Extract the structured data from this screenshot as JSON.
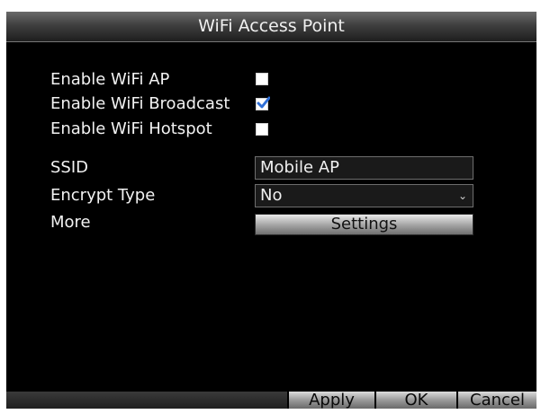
{
  "window": {
    "title": "WiFi Access Point"
  },
  "options": [
    {
      "label": "Enable WiFi AP",
      "checked": false
    },
    {
      "label": "Enable WiFi Broadcast",
      "checked": true
    },
    {
      "label": "Enable WiFi Hotspot",
      "checked": false
    }
  ],
  "ssid": {
    "label": "SSID",
    "value": "Mobile AP"
  },
  "encrypt": {
    "label": "Encrypt Type",
    "value": "No"
  },
  "more": {
    "label": "More",
    "button_label": "Settings"
  },
  "footer": {
    "apply_label": "Apply",
    "ok_label": "OK",
    "cancel_label": "Cancel"
  },
  "colors": {
    "background": "#000000",
    "text": "#f2f2f2",
    "checkmark": "#2f6fd6"
  }
}
